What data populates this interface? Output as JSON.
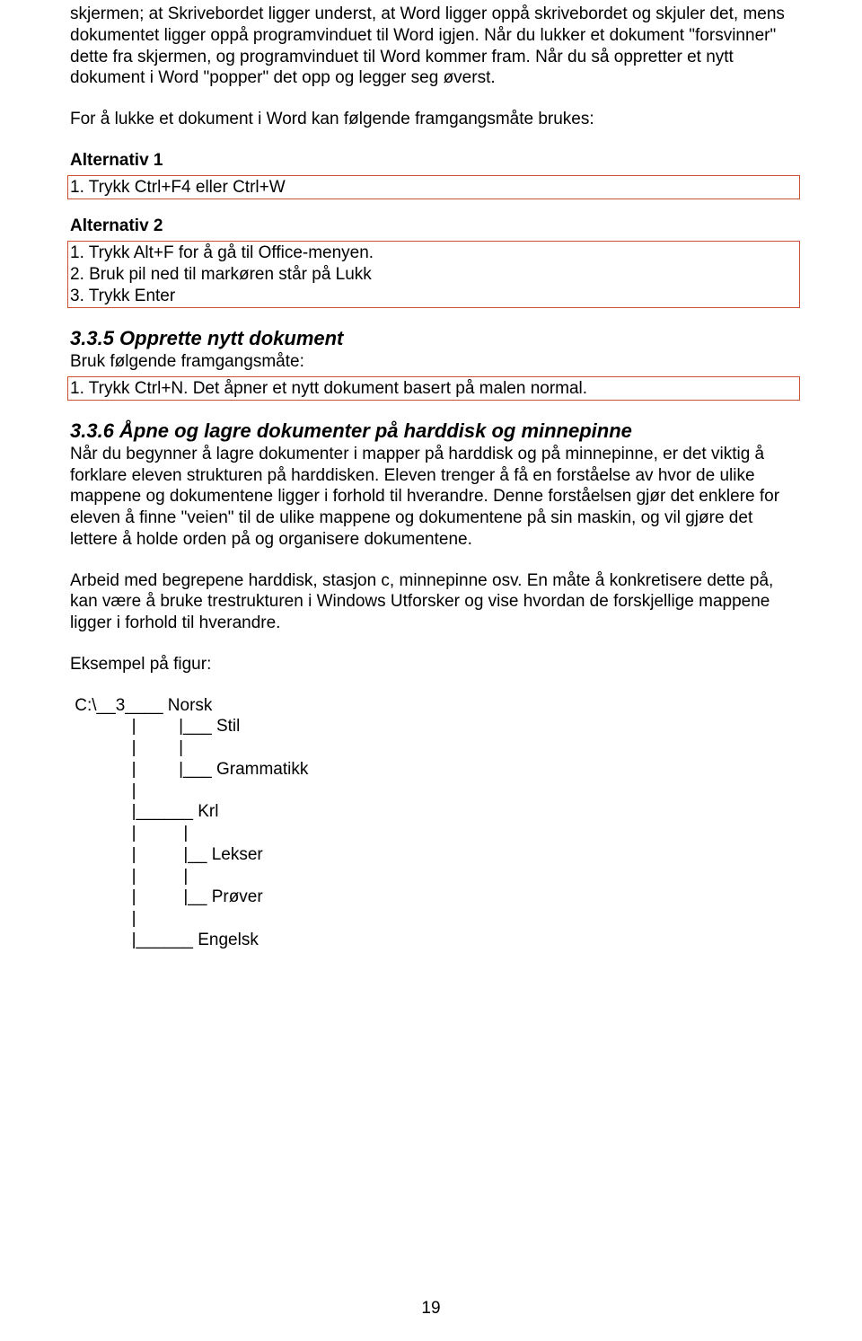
{
  "intro": {
    "p1": "skjermen; at Skrivebordet ligger underst, at Word ligger oppå skrivebordet og skjuler det, mens dokumentet ligger oppå programvinduet til Word igjen. Når du lukker et dokument \"forsvinner\" dette fra skjermen, og programvinduet til Word kommer fram. Når du så oppretter et nytt dokument i Word \"popper\" det opp og legger seg øverst.",
    "p2": "For å lukke et dokument i Word kan følgende framgangsmåte brukes:"
  },
  "alt1": {
    "title": "Alternativ 1",
    "item1": "1. Trykk Ctrl+F4 eller Ctrl+W"
  },
  "alt2": {
    "title": "Alternativ 2",
    "item1": "1. Trykk Alt+F for å gå til Office-menyen.",
    "item2": "2. Bruk pil ned til markøren står på Lukk",
    "item3": "3. Trykk Enter"
  },
  "sec335": {
    "heading": "3.3.5 Opprette nytt dokument",
    "p1": "Bruk følgende framgangsmåte:",
    "item1": "1. Trykk Ctrl+N. Det åpner et nytt dokument basert på malen normal."
  },
  "sec336": {
    "heading": "3.3.6 Åpne og lagre dokumenter på harddisk og minnepinne",
    "p1": "Når du begynner å lagre dokumenter i mapper på harddisk og på minnepinne, er det viktig å forklare eleven strukturen på harddisken. Eleven trenger å få en forståelse av hvor de ulike mappene og dokumentene ligger i forhold til hverandre. Denne forståelsen gjør det enklere for eleven å finne \"veien\" til de ulike mappene og dokumentene på sin maskin, og vil gjøre det lettere å holde orden på og organisere dokumentene.",
    "p2": "Arbeid med begrepene harddisk, stasjon c, minnepinne osv. En måte å konkretisere dette på, kan være å bruke trestrukturen i Windows Utforsker og vise hvordan de forskjellige mappene ligger i forhold til hverandre.",
    "p3": "Eksempel på figur:"
  },
  "tree": " C:\\__3____ Norsk\n             |         |___ Stil\n             |         |\n             |         |___ Grammatikk\n             |\n             |______ Krl\n             |          |\n             |          |__ Lekser\n             |          |\n             |          |__ Prøver\n             |\n             |______ Engelsk",
  "pageNumber": "19"
}
